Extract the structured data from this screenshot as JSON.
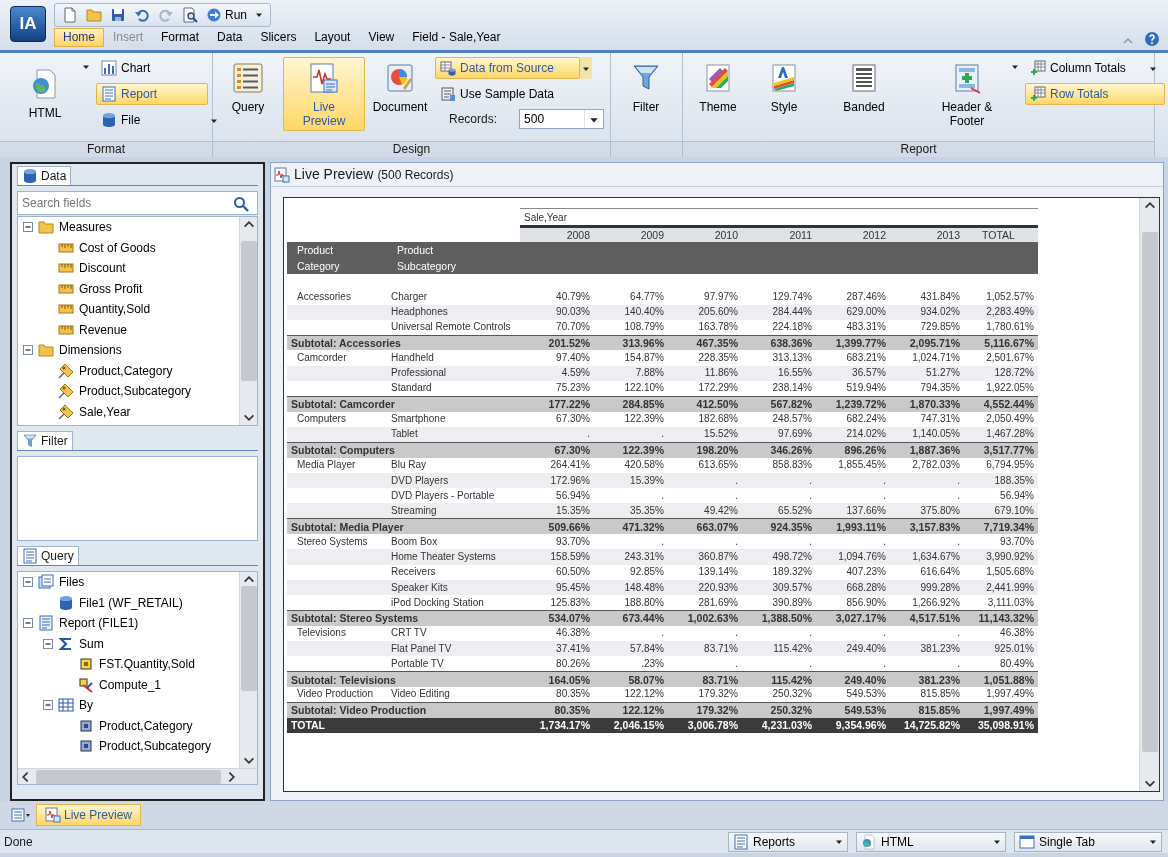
{
  "app": {
    "logo": "IA",
    "quick_access": {
      "run_label": "Run"
    }
  },
  "menu_tabs": [
    {
      "label": "Home",
      "selected": true,
      "disabled": false
    },
    {
      "label": "Insert",
      "selected": false,
      "disabled": true
    },
    {
      "label": "Format",
      "selected": false,
      "disabled": false
    },
    {
      "label": "Data",
      "selected": false,
      "disabled": false
    },
    {
      "label": "Slicers",
      "selected": false,
      "disabled": false
    },
    {
      "label": "Layout",
      "selected": false,
      "disabled": false
    },
    {
      "label": "View",
      "selected": false,
      "disabled": false
    },
    {
      "label": "Field - Sale,Year",
      "selected": false,
      "disabled": false
    }
  ],
  "ribbon": {
    "format": {
      "group_label": "Format",
      "output_button": "HTML",
      "options": [
        {
          "label": "Chart",
          "selected": false
        },
        {
          "label": "Report",
          "selected": true
        },
        {
          "label": "File",
          "selected": false
        }
      ]
    },
    "design": {
      "group_label": "Design",
      "buttons": [
        {
          "label": "Query",
          "selected": false
        },
        {
          "label": "Live Preview",
          "selected": true
        },
        {
          "label": "Document",
          "selected": false
        }
      ],
      "source_options": [
        {
          "label": "Data from Source",
          "selected": true
        },
        {
          "label": "Use Sample Data",
          "selected": false
        }
      ],
      "records_label": "Records:",
      "records_value": "500"
    },
    "filter": {
      "label": "Filter"
    },
    "report": {
      "group_label": "Report",
      "buttons": [
        "Theme",
        "Style",
        "Banded",
        "Header & Footer"
      ],
      "totals": [
        {
          "label": "Column Totals",
          "selected": false
        },
        {
          "label": "Row Totals",
          "selected": true
        }
      ]
    }
  },
  "data_panel": {
    "title": "Data",
    "search": {
      "placeholder": "Search fields"
    },
    "tree": [
      {
        "label": "Measures",
        "kind": "folder",
        "expanded": true,
        "children": [
          {
            "label": "Cost of Goods",
            "kind": "measure"
          },
          {
            "label": "Discount",
            "kind": "measure"
          },
          {
            "label": "Gross Profit",
            "kind": "measure"
          },
          {
            "label": "Quantity,Sold",
            "kind": "measure"
          },
          {
            "label": "Revenue",
            "kind": "measure"
          }
        ]
      },
      {
        "label": "Dimensions",
        "kind": "folder",
        "expanded": true,
        "children": [
          {
            "label": "Product,Category",
            "kind": "dimension"
          },
          {
            "label": "Product,Subcategory",
            "kind": "dimension"
          },
          {
            "label": "Sale,Year",
            "kind": "dimension"
          }
        ]
      }
    ]
  },
  "filter_panel": {
    "title": "Filter"
  },
  "query_panel": {
    "title": "Query",
    "tree": [
      {
        "label": "Files",
        "kind": "files",
        "expanded": true,
        "children": [
          {
            "label": "File1 (WF_RETAIL)",
            "kind": "file"
          }
        ]
      },
      {
        "label": "Report (FILE1)",
        "kind": "report",
        "expanded": true,
        "children": [
          {
            "label": "Sum",
            "kind": "sum",
            "expanded": true,
            "children": [
              {
                "label": "FST.Quantity,Sold",
                "kind": "measure_field"
              },
              {
                "label": "Compute_1",
                "kind": "compute"
              }
            ]
          },
          {
            "label": "By",
            "kind": "by",
            "expanded": true,
            "children": [
              {
                "label": "Product,Category",
                "kind": "dimension_field"
              },
              {
                "label": "Product,Subcategory",
                "kind": "dimension_field"
              }
            ]
          }
        ]
      }
    ]
  },
  "preview": {
    "title": "Live Preview",
    "record_count": "(500 Records)",
    "report": {
      "across_label": "Sale,Year",
      "row_headers": [
        "Product Category",
        "Product Subcategory"
      ],
      "columns": [
        "2008",
        "2009",
        "2010",
        "2011",
        "2012",
        "2013",
        "TOTAL"
      ],
      "rows": [
        {
          "kind": "detail",
          "category": "Accessories",
          "subcategory": "Charger",
          "values": [
            "40.79%",
            "64.77%",
            "97.97%",
            "129.74%",
            "287.46%",
            "431.84%",
            "1,052.57%"
          ]
        },
        {
          "kind": "detail",
          "subcategory": "Headphones",
          "values": [
            "90.03%",
            "140.40%",
            "205.60%",
            "284.44%",
            "629.00%",
            "934.02%",
            "2,283.49%"
          ]
        },
        {
          "kind": "detail",
          "subcategory": "Universal Remote Controls",
          "values": [
            "70.70%",
            "108.79%",
            "163.78%",
            "224.18%",
            "483.31%",
            "729.85%",
            "1,780.61%"
          ]
        },
        {
          "kind": "subtotal",
          "label": "Subtotal: Accessories",
          "values": [
            "201.52%",
            "313.96%",
            "467.35%",
            "638.36%",
            "1,399.77%",
            "2,095.71%",
            "5,116.67%"
          ]
        },
        {
          "kind": "detail",
          "category": "Camcorder",
          "subcategory": "Handheld",
          "values": [
            "97.40%",
            "154.87%",
            "228.35%",
            "313.13%",
            "683.21%",
            "1,024.71%",
            "2,501.67%"
          ]
        },
        {
          "kind": "detail",
          "subcategory": "Professional",
          "values": [
            "4.59%",
            "7.88%",
            "11.86%",
            "16.55%",
            "36.57%",
            "51.27%",
            "128.72%"
          ]
        },
        {
          "kind": "detail",
          "subcategory": "Standard",
          "values": [
            "75.23%",
            "122.10%",
            "172.29%",
            "238.14%",
            "519.94%",
            "794.35%",
            "1,922.05%"
          ]
        },
        {
          "kind": "subtotal",
          "label": "Subtotal: Camcorder",
          "values": [
            "177.22%",
            "284.85%",
            "412.50%",
            "567.82%",
            "1,239.72%",
            "1,870.33%",
            "4,552.44%"
          ]
        },
        {
          "kind": "detail",
          "category": "Computers",
          "subcategory": "Smartphone",
          "values": [
            "67.30%",
            "122.39%",
            "182.68%",
            "248.57%",
            "682.24%",
            "747.31%",
            "2,050.49%"
          ]
        },
        {
          "kind": "detail",
          "subcategory": "Tablet",
          "values": [
            ".",
            ".",
            "15.52%",
            "97.69%",
            "214.02%",
            "1,140.05%",
            "1,467.28%"
          ]
        },
        {
          "kind": "subtotal",
          "label": "Subtotal: Computers",
          "values": [
            "67.30%",
            "122.39%",
            "198.20%",
            "346.26%",
            "896.26%",
            "1,887.36%",
            "3,517.77%"
          ]
        },
        {
          "kind": "detail",
          "category": "Media Player",
          "subcategory": "Blu Ray",
          "values": [
            "264.41%",
            "420.58%",
            "613.65%",
            "858.83%",
            "1,855.45%",
            "2,782.03%",
            "6,794.95%"
          ]
        },
        {
          "kind": "detail",
          "subcategory": "DVD Players",
          "values": [
            "172.96%",
            "15.39%",
            ".",
            ".",
            ".",
            ".",
            "188.35%"
          ]
        },
        {
          "kind": "detail",
          "subcategory": "DVD Players - Portable",
          "values": [
            "56.94%",
            ".",
            ".",
            ".",
            ".",
            ".",
            "56.94%"
          ]
        },
        {
          "kind": "detail",
          "subcategory": "Streaming",
          "values": [
            "15.35%",
            "35.35%",
            "49.42%",
            "65.52%",
            "137.66%",
            "375.80%",
            "679.10%"
          ]
        },
        {
          "kind": "subtotal",
          "label": "Subtotal: Media Player",
          "values": [
            "509.66%",
            "471.32%",
            "663.07%",
            "924.35%",
            "1,993.11%",
            "3,157.83%",
            "7,719.34%"
          ]
        },
        {
          "kind": "detail",
          "category": "Stereo Systems",
          "subcategory": "Boom Box",
          "values": [
            "93.70%",
            ".",
            ".",
            ".",
            ".",
            ".",
            "93.70%"
          ]
        },
        {
          "kind": "detail",
          "subcategory": "Home Theater Systems",
          "values": [
            "158.59%",
            "243.31%",
            "360.87%",
            "498.72%",
            "1,094.76%",
            "1,634.67%",
            "3,990.92%"
          ]
        },
        {
          "kind": "detail",
          "subcategory": "Receivers",
          "values": [
            "60.50%",
            "92.85%",
            "139.14%",
            "189.32%",
            "407.23%",
            "616.64%",
            "1,505.68%"
          ]
        },
        {
          "kind": "detail",
          "subcategory": "Speaker Kits",
          "values": [
            "95.45%",
            "148.48%",
            "220.93%",
            "309.57%",
            "668.28%",
            "999.28%",
            "2,441.99%"
          ]
        },
        {
          "kind": "detail",
          "subcategory": "iPod Docking Station",
          "values": [
            "125.83%",
            "188.80%",
            "281.69%",
            "390.89%",
            "856.90%",
            "1,266.92%",
            "3,111.03%"
          ]
        },
        {
          "kind": "subtotal",
          "label": "Subtotal: Stereo Systems",
          "values": [
            "534.07%",
            "673.44%",
            "1,002.63%",
            "1,388.50%",
            "3,027.17%",
            "4,517.51%",
            "11,143.32%"
          ]
        },
        {
          "kind": "detail",
          "category": "Televisions",
          "subcategory": "CRT TV",
          "values": [
            "46.38%",
            ".",
            ".",
            ".",
            ".",
            ".",
            "46.38%"
          ]
        },
        {
          "kind": "detail",
          "subcategory": "Flat Panel TV",
          "values": [
            "37.41%",
            "57.84%",
            "83.71%",
            "115.42%",
            "249.40%",
            "381.23%",
            "925.01%"
          ]
        },
        {
          "kind": "detail",
          "subcategory": "Portable TV",
          "values": [
            "80.26%",
            ".23%",
            ".",
            ".",
            ".",
            ".",
            "80.49%"
          ]
        },
        {
          "kind": "subtotal",
          "label": "Subtotal: Televisions",
          "values": [
            "164.05%",
            "58.07%",
            "83.71%",
            "115.42%",
            "249.40%",
            "381.23%",
            "1,051.88%"
          ]
        },
        {
          "kind": "detail",
          "category": "Video Production",
          "subcategory": "Video Editing",
          "values": [
            "80.35%",
            "122.12%",
            "179.32%",
            "250.32%",
            "549.53%",
            "815.85%",
            "1,997.49%"
          ]
        },
        {
          "kind": "subtotal",
          "label": "Subtotal: Video Production",
          "values": [
            "80.35%",
            "122.12%",
            "179.32%",
            "250.32%",
            "549.53%",
            "815.85%",
            "1,997.49%"
          ]
        },
        {
          "kind": "total",
          "label": "TOTAL",
          "values": [
            "1,734.17%",
            "2,046.15%",
            "3,006.78%",
            "4,231.03%",
            "9,354.96%",
            "14,725.82%",
            "35,098.91%"
          ]
        }
      ]
    }
  },
  "bottom_tabs": [
    {
      "label": "Live Preview",
      "selected": true
    }
  ],
  "status_bar": {
    "text": "Done",
    "dropdowns": [
      "Reports",
      "HTML",
      "Single Tab"
    ]
  }
}
